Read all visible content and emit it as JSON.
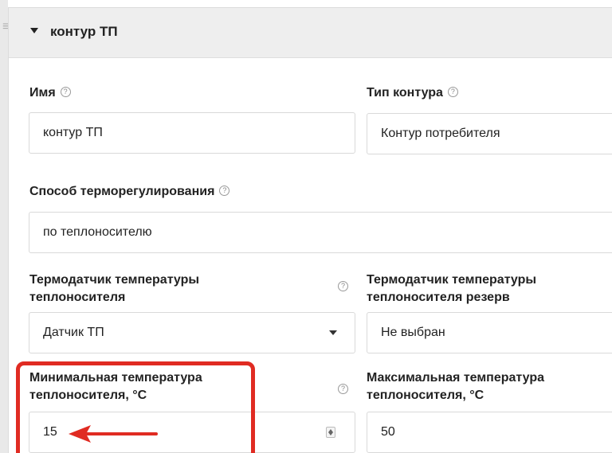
{
  "panel": {
    "title": "контур ТП",
    "drag_handle": "≡"
  },
  "name": {
    "label": "Имя",
    "value": "контур ТП"
  },
  "contour_type": {
    "label": "Тип контура",
    "value": "Контур потребителя"
  },
  "regulation_method": {
    "label": "Способ терморегулирования",
    "value": "по теплоносителю"
  },
  "coolant_sensor": {
    "label_line1": "Термодатчик температуры",
    "label_line2": "теплоносителя",
    "value": "Датчик ТП"
  },
  "coolant_sensor_reserve": {
    "label_line1": "Термодатчик температуры",
    "label_line2": "теплоносителя резерв",
    "value": "Не выбран"
  },
  "min_coolant_temp": {
    "label_line1": "Минимальная температура",
    "label_line2": "теплоносителя, °C",
    "value": "15"
  },
  "max_coolant_temp": {
    "label_line1": "Максимальная температура",
    "label_line2": "теплоносителя, °C",
    "value": "50"
  },
  "help_glyph": "?",
  "annotation": {
    "highlight_color": "#e02b22",
    "arrow_color": "#e02b22"
  }
}
